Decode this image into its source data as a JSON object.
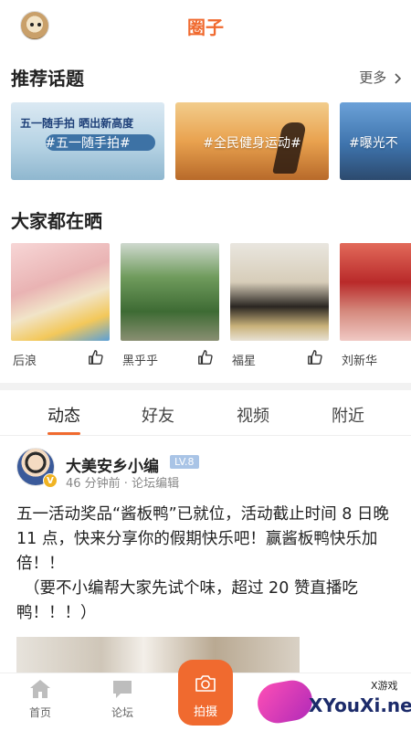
{
  "header": {
    "title": "圈子"
  },
  "recommended": {
    "title": "推荐话题",
    "more_label": "更多",
    "topics": [
      {
        "label": "#五一随手拍#",
        "heading": "五一随手拍 晒出新高度"
      },
      {
        "label": "#全民健身运动#"
      },
      {
        "label": "#曝光不"
      }
    ]
  },
  "sharing": {
    "title": "大家都在晒",
    "items": [
      {
        "name": "后浪"
      },
      {
        "name": "黑乎乎"
      },
      {
        "name": "福星"
      },
      {
        "name": "刘新华"
      }
    ]
  },
  "tabs": [
    {
      "label": "动态",
      "active": true
    },
    {
      "label": "好友",
      "active": false
    },
    {
      "label": "视频",
      "active": false
    },
    {
      "label": "附近",
      "active": false
    }
  ],
  "post": {
    "author": "大美安乡小编",
    "level": "LV.8",
    "verified_badge": "V",
    "meta": "46 分钟前 · 论坛编辑",
    "body_line1": "五一活动奖品“酱板鸭”已就位，活动截止时间 8 日晚 11 点，快来分享你的假期快乐吧！赢酱板鸭快乐加倍！！",
    "body_line2": "（要不小编帮大家先试个味，超过 20 赞直播吃鸭！！！）"
  },
  "bottom_nav": {
    "home_label": "首页",
    "forum_label": "论坛",
    "camera_label": "拍摄"
  },
  "watermark": {
    "site": "XYouXi.net",
    "tag": "X游戏"
  },
  "colors": {
    "accent": "#f06a2f",
    "level_badge": "#a9c4e6",
    "verified": "#f0b323"
  },
  "icons": {
    "more": "chevron-right-icon",
    "like": "thumbs-up-icon",
    "home": "home-icon",
    "forum": "chat-bubble-icon",
    "camera": "camera-icon"
  }
}
